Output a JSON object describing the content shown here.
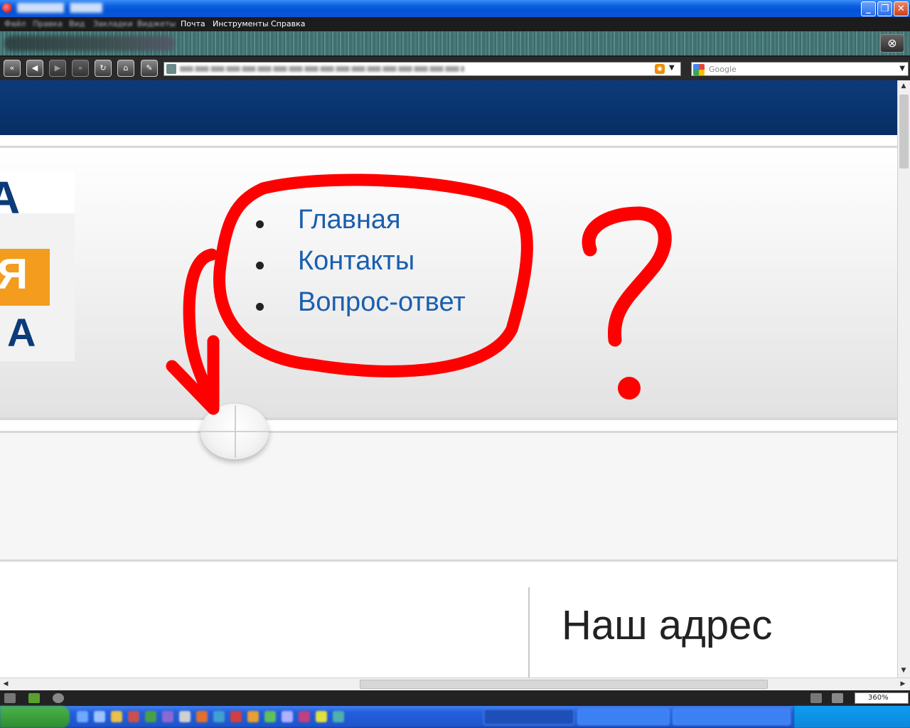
{
  "window": {
    "minimize_glyph": "_",
    "maximize_glyph": "❐",
    "close_glyph": "✕"
  },
  "menubar": {
    "items": [
      {
        "label": "Файл",
        "legible": false
      },
      {
        "label": "Правка",
        "legible": false
      },
      {
        "label": "Вид",
        "legible": false
      },
      {
        "label": "Закладки",
        "legible": false
      },
      {
        "label": "Виджеты",
        "legible": false
      },
      {
        "label": "Почта",
        "legible": true
      },
      {
        "label": "Инструменты",
        "legible": true
      },
      {
        "label": "Справка",
        "legible": true
      }
    ]
  },
  "toolbar": {
    "search_placeholder": "Google",
    "closed_tabs_icon": "trash-reopen-icon",
    "buttons": [
      "rewind-icon",
      "back-icon",
      "forward-icon",
      "fast-forward-icon",
      "reload-icon",
      "home-icon",
      "edit-icon"
    ]
  },
  "page": {
    "nav": [
      "Главная",
      "Контакты",
      "Вопрос-ответ"
    ],
    "logo": {
      "letter_top": "А",
      "letter_mid": "Я",
      "letter_bottom": "А"
    },
    "address_heading": "Наш адрес",
    "header_color": "#0d3b7a",
    "link_color": "#1a5fae"
  },
  "annotation": {
    "question_mark": "?",
    "color": "#ff0000"
  },
  "statusbar": {
    "zoom": "360%"
  },
  "colors": {
    "titlebar": "#0a5fe0",
    "menubar": "#1c1c1c",
    "tabbar": "#4a7c7c",
    "taskbar": "#245edb"
  }
}
